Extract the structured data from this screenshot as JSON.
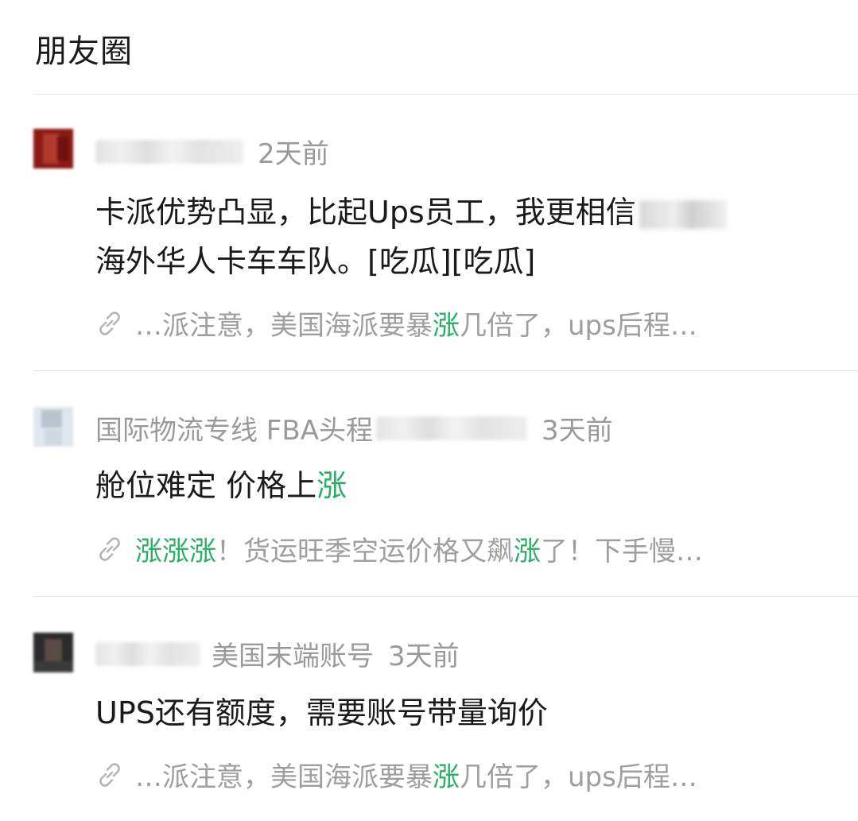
{
  "header": {
    "title": "朋友圈"
  },
  "posts": [
    {
      "time": "2天前",
      "name_visible": "",
      "body_lines": [
        "卡派优势凸显，比起Ups员工，我更相信",
        "海外华人卡车车队。[吃瓜][吃瓜]"
      ],
      "link": {
        "segments": [
          {
            "text": "…派注意，美国海派要暴"
          },
          {
            "text": "涨",
            "highlight": true
          },
          {
            "text": "几倍了，ups后程…"
          }
        ]
      }
    },
    {
      "time": "3天前",
      "name_visible": "国际物流专线 FBA头程",
      "body_lines": [
        "舱位难定 价格上",
        "涨"
      ],
      "link": {
        "segments": [
          {
            "text": "涨涨涨",
            "highlight": true
          },
          {
            "text": "！货运旺季空运价格又飙"
          },
          {
            "text": "涨",
            "highlight": true
          },
          {
            "text": "了！下手慢…"
          }
        ]
      }
    },
    {
      "time": "3天前",
      "name_visible": "美国末端账号",
      "body_lines": [
        "UPS还有额度，需要账号带量询价"
      ],
      "link": {
        "segments": [
          {
            "text": "…派注意，美国海派要暴"
          },
          {
            "text": "涨",
            "highlight": true
          },
          {
            "text": "几倍了，ups后程…"
          }
        ]
      }
    }
  ],
  "colors": {
    "highlight": "#2aae67",
    "meta": "#9a9a9a",
    "divider": "#e6e6e6"
  },
  "icons": {
    "link": "link-icon"
  }
}
